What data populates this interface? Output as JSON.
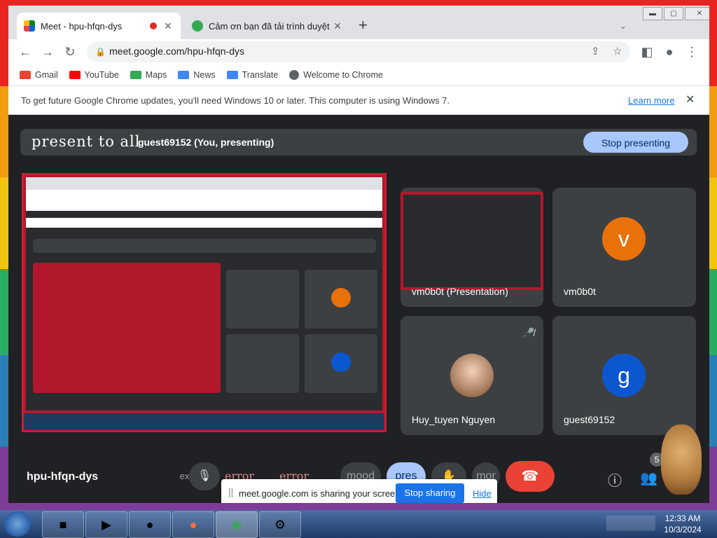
{
  "browser": {
    "tabs": [
      {
        "title": "Meet - hpu-hfqn-dys",
        "recording": true,
        "active": true
      },
      {
        "title": "Cảm ơn bạn đã tải trình duyệt Chrome",
        "active": false
      }
    ],
    "new_tab_icon": "+",
    "tab_search_icon": "chevron-down",
    "url": "meet.google.com/hpu-hfqn-dys",
    "bookmarks": [
      {
        "label": "Gmail",
        "color": "#ea4335"
      },
      {
        "label": "YouTube",
        "color": "#ff0000"
      },
      {
        "label": "Maps",
        "color": "#34a853"
      },
      {
        "label": "News",
        "color": "#4285f4"
      },
      {
        "label": "Translate",
        "color": "#4285f4"
      },
      {
        "label": "Welcome to Chrome",
        "color": "#5f6368"
      }
    ],
    "infobar": {
      "message": "To get future Google Chrome updates, you'll need Windows 10 or later. This computer is using Windows 7.",
      "link": "Learn more"
    }
  },
  "meet": {
    "presentation_title": "present to all",
    "presenter": "guest69152 (You, presenting)",
    "stop_presenting": "Stop presenting",
    "participants": [
      {
        "name": "vm0b0t (Presentation)",
        "type": "presentation"
      },
      {
        "name": "vm0b0t",
        "initial": "v",
        "color": "#e8710a"
      },
      {
        "name": "Huy_tuyen Nguyen",
        "type": "photo",
        "muted": true
      },
      {
        "name": "guest69152",
        "initial": "g",
        "color": "#0b57d0"
      }
    ],
    "meeting_code": "hpu-hfqn-dys",
    "controls": [
      {
        "label": "expand",
        "icon": ""
      },
      {
        "label": "",
        "icon": "mic-icon"
      },
      {
        "label": "error",
        "icon": ""
      },
      {
        "label": "error",
        "icon": ""
      },
      {
        "label": "mood",
        "icon": ""
      },
      {
        "label": "pres",
        "icon": ""
      },
      {
        "label": "",
        "icon": "hand-icon"
      },
      {
        "label": "mor",
        "icon": ""
      }
    ],
    "participant_count": "5",
    "share_notice": {
      "message": "meet.google.com is sharing your screen.",
      "stop": "Stop sharing",
      "hide": "Hide"
    }
  },
  "taskbar": {
    "time": "12:33 AM",
    "date": "10/3/2024"
  }
}
